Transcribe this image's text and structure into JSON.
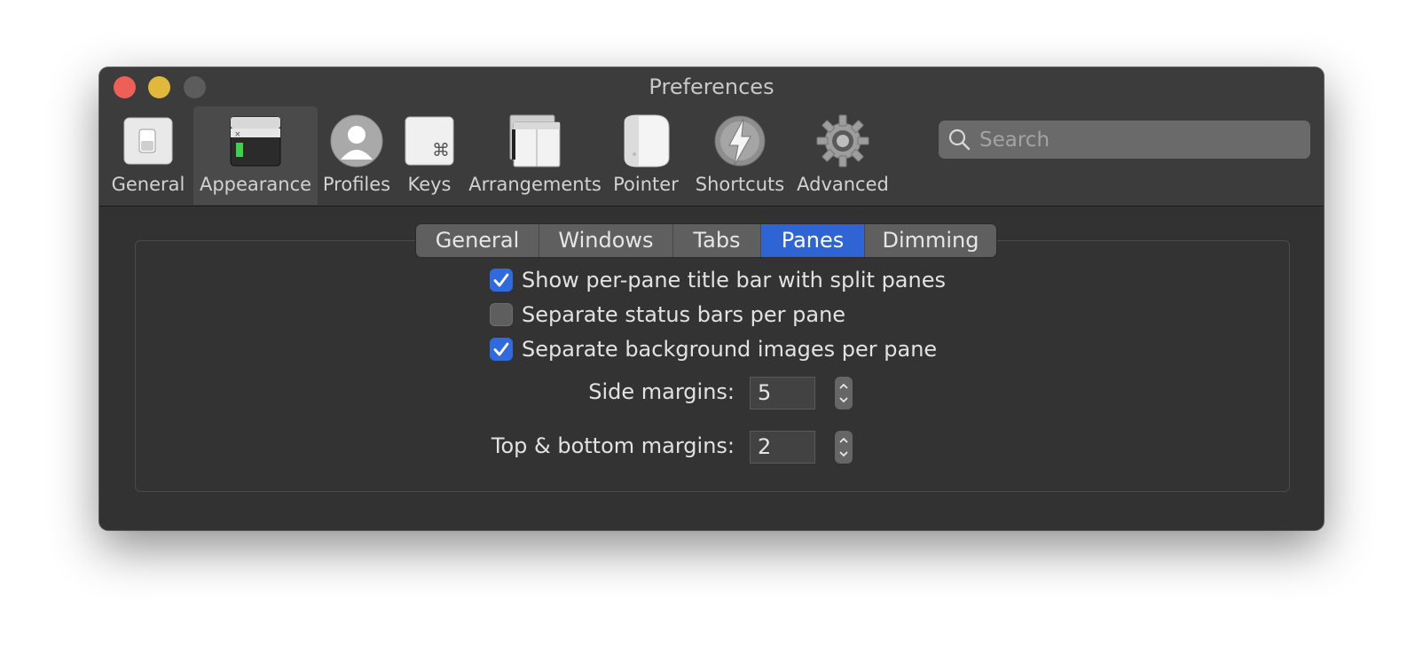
{
  "window": {
    "title": "Preferences"
  },
  "toolbar": {
    "items": [
      {
        "label": "General",
        "icon": "switch-icon"
      },
      {
        "label": "Appearance",
        "icon": "window-icon",
        "selected": true
      },
      {
        "label": "Profiles",
        "icon": "user-icon"
      },
      {
        "label": "Keys",
        "icon": "command-key-icon"
      },
      {
        "label": "Arrangements",
        "icon": "windows-arrangement-icon"
      },
      {
        "label": "Pointer",
        "icon": "mouse-icon"
      },
      {
        "label": "Shortcuts",
        "icon": "lightning-icon"
      },
      {
        "label": "Advanced",
        "icon": "gear-icon"
      }
    ]
  },
  "search": {
    "placeholder": "Search"
  },
  "tabs": {
    "items": [
      "General",
      "Windows",
      "Tabs",
      "Panes",
      "Dimming"
    ],
    "active": "Panes"
  },
  "options": {
    "per_pane_title_bar": {
      "label": "Show per-pane title bar with split panes",
      "checked": true
    },
    "separate_status_bars": {
      "label": "Separate status bars per pane",
      "checked": false
    },
    "separate_background_images": {
      "label": "Separate background images per pane",
      "checked": true
    }
  },
  "margins": {
    "side": {
      "label": "Side margins:",
      "value": "5"
    },
    "top_bottom": {
      "label": "Top & bottom margins:",
      "value": "2"
    }
  },
  "colors": {
    "accent": "#2f64d4",
    "checkbox_checked": "#2f6bde"
  }
}
